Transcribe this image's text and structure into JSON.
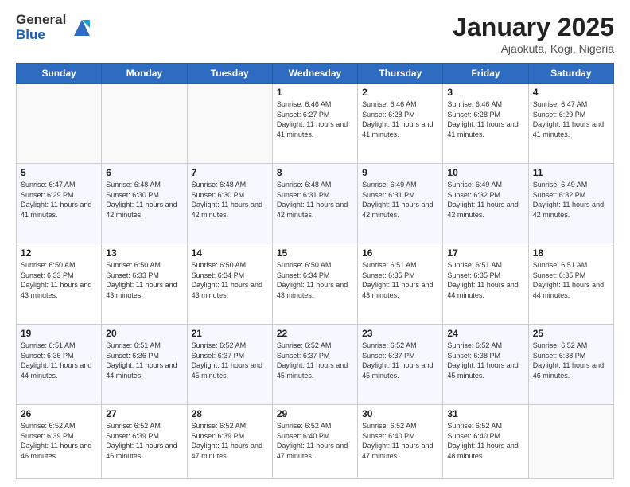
{
  "header": {
    "logo_general": "General",
    "logo_blue": "Blue",
    "month_title": "January 2025",
    "subtitle": "Ajaokuta, Kogi, Nigeria"
  },
  "days_of_week": [
    "Sunday",
    "Monday",
    "Tuesday",
    "Wednesday",
    "Thursday",
    "Friday",
    "Saturday"
  ],
  "weeks": [
    [
      {
        "day": "",
        "info": ""
      },
      {
        "day": "",
        "info": ""
      },
      {
        "day": "",
        "info": ""
      },
      {
        "day": "1",
        "info": "Sunrise: 6:46 AM\nSunset: 6:27 PM\nDaylight: 11 hours and 41 minutes."
      },
      {
        "day": "2",
        "info": "Sunrise: 6:46 AM\nSunset: 6:28 PM\nDaylight: 11 hours and 41 minutes."
      },
      {
        "day": "3",
        "info": "Sunrise: 6:46 AM\nSunset: 6:28 PM\nDaylight: 11 hours and 41 minutes."
      },
      {
        "day": "4",
        "info": "Sunrise: 6:47 AM\nSunset: 6:29 PM\nDaylight: 11 hours and 41 minutes."
      }
    ],
    [
      {
        "day": "5",
        "info": "Sunrise: 6:47 AM\nSunset: 6:29 PM\nDaylight: 11 hours and 41 minutes."
      },
      {
        "day": "6",
        "info": "Sunrise: 6:48 AM\nSunset: 6:30 PM\nDaylight: 11 hours and 42 minutes."
      },
      {
        "day": "7",
        "info": "Sunrise: 6:48 AM\nSunset: 6:30 PM\nDaylight: 11 hours and 42 minutes."
      },
      {
        "day": "8",
        "info": "Sunrise: 6:48 AM\nSunset: 6:31 PM\nDaylight: 11 hours and 42 minutes."
      },
      {
        "day": "9",
        "info": "Sunrise: 6:49 AM\nSunset: 6:31 PM\nDaylight: 11 hours and 42 minutes."
      },
      {
        "day": "10",
        "info": "Sunrise: 6:49 AM\nSunset: 6:32 PM\nDaylight: 11 hours and 42 minutes."
      },
      {
        "day": "11",
        "info": "Sunrise: 6:49 AM\nSunset: 6:32 PM\nDaylight: 11 hours and 42 minutes."
      }
    ],
    [
      {
        "day": "12",
        "info": "Sunrise: 6:50 AM\nSunset: 6:33 PM\nDaylight: 11 hours and 43 minutes."
      },
      {
        "day": "13",
        "info": "Sunrise: 6:50 AM\nSunset: 6:33 PM\nDaylight: 11 hours and 43 minutes."
      },
      {
        "day": "14",
        "info": "Sunrise: 6:50 AM\nSunset: 6:34 PM\nDaylight: 11 hours and 43 minutes."
      },
      {
        "day": "15",
        "info": "Sunrise: 6:50 AM\nSunset: 6:34 PM\nDaylight: 11 hours and 43 minutes."
      },
      {
        "day": "16",
        "info": "Sunrise: 6:51 AM\nSunset: 6:35 PM\nDaylight: 11 hours and 43 minutes."
      },
      {
        "day": "17",
        "info": "Sunrise: 6:51 AM\nSunset: 6:35 PM\nDaylight: 11 hours and 44 minutes."
      },
      {
        "day": "18",
        "info": "Sunrise: 6:51 AM\nSunset: 6:35 PM\nDaylight: 11 hours and 44 minutes."
      }
    ],
    [
      {
        "day": "19",
        "info": "Sunrise: 6:51 AM\nSunset: 6:36 PM\nDaylight: 11 hours and 44 minutes."
      },
      {
        "day": "20",
        "info": "Sunrise: 6:51 AM\nSunset: 6:36 PM\nDaylight: 11 hours and 44 minutes."
      },
      {
        "day": "21",
        "info": "Sunrise: 6:52 AM\nSunset: 6:37 PM\nDaylight: 11 hours and 45 minutes."
      },
      {
        "day": "22",
        "info": "Sunrise: 6:52 AM\nSunset: 6:37 PM\nDaylight: 11 hours and 45 minutes."
      },
      {
        "day": "23",
        "info": "Sunrise: 6:52 AM\nSunset: 6:37 PM\nDaylight: 11 hours and 45 minutes."
      },
      {
        "day": "24",
        "info": "Sunrise: 6:52 AM\nSunset: 6:38 PM\nDaylight: 11 hours and 45 minutes."
      },
      {
        "day": "25",
        "info": "Sunrise: 6:52 AM\nSunset: 6:38 PM\nDaylight: 11 hours and 46 minutes."
      }
    ],
    [
      {
        "day": "26",
        "info": "Sunrise: 6:52 AM\nSunset: 6:39 PM\nDaylight: 11 hours and 46 minutes."
      },
      {
        "day": "27",
        "info": "Sunrise: 6:52 AM\nSunset: 6:39 PM\nDaylight: 11 hours and 46 minutes."
      },
      {
        "day": "28",
        "info": "Sunrise: 6:52 AM\nSunset: 6:39 PM\nDaylight: 11 hours and 47 minutes."
      },
      {
        "day": "29",
        "info": "Sunrise: 6:52 AM\nSunset: 6:40 PM\nDaylight: 11 hours and 47 minutes."
      },
      {
        "day": "30",
        "info": "Sunrise: 6:52 AM\nSunset: 6:40 PM\nDaylight: 11 hours and 47 minutes."
      },
      {
        "day": "31",
        "info": "Sunrise: 6:52 AM\nSunset: 6:40 PM\nDaylight: 11 hours and 48 minutes."
      },
      {
        "day": "",
        "info": ""
      }
    ]
  ]
}
